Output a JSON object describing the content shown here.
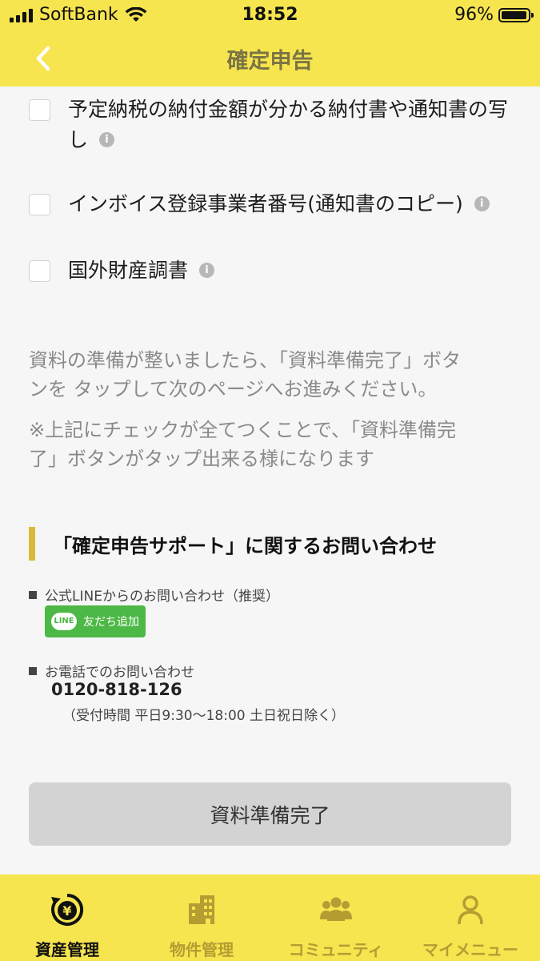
{
  "status_bar": {
    "carrier": "SoftBank",
    "time": "18:52",
    "battery": "96%"
  },
  "header": {
    "title": "確定申告",
    "back_icon": "chevron-left-icon"
  },
  "checklist": [
    {
      "label_line1": "予定納税の納付金額が分かる納付書や通知書の写",
      "label_line2": "し",
      "info": "i"
    },
    {
      "label": "インボイス登録事業者番号(通知書のコピー)",
      "info": "i"
    },
    {
      "label": "国外財産調書",
      "info": "i"
    }
  ],
  "instructions": {
    "para1_line1": "資料の準備が整いましたら、「資料準備完了」ボタ",
    "para1_line2": "ンを タップして次のページへお進みください。",
    "para2_line1": "※上記にチェックが全てつくことで、「資料準備完",
    "para2_line2": "了」ボタンがタップ出来る様になります"
  },
  "contact": {
    "heading": "「確定申告サポート」に関するお問い合わせ",
    "line_label": "公式LINEからのお問い合わせ（推奨）",
    "line_logo": "LINE",
    "line_button": "友だち追加",
    "phone_label": "お電話でのお問い合わせ",
    "phone_number": "0120-818-126",
    "phone_hours": "（受付時間 平日9:30〜18:00 土日祝日除く）"
  },
  "done_button": "資料準備完了",
  "tabbar": {
    "tabs": [
      {
        "label": "資産管理",
        "icon": "yen-refresh-icon",
        "active": true
      },
      {
        "label": "物件管理",
        "icon": "building-icon",
        "active": false
      },
      {
        "label": "コミュニティ",
        "icon": "people-icon",
        "active": false
      },
      {
        "label": "マイメニュー",
        "icon": "person-icon",
        "active": false
      }
    ]
  },
  "colors": {
    "header_bg": "#f6e54f",
    "accent_bar": "#d8b93a",
    "line_green": "#4cb845",
    "inactive_tab": "#b59d32"
  }
}
